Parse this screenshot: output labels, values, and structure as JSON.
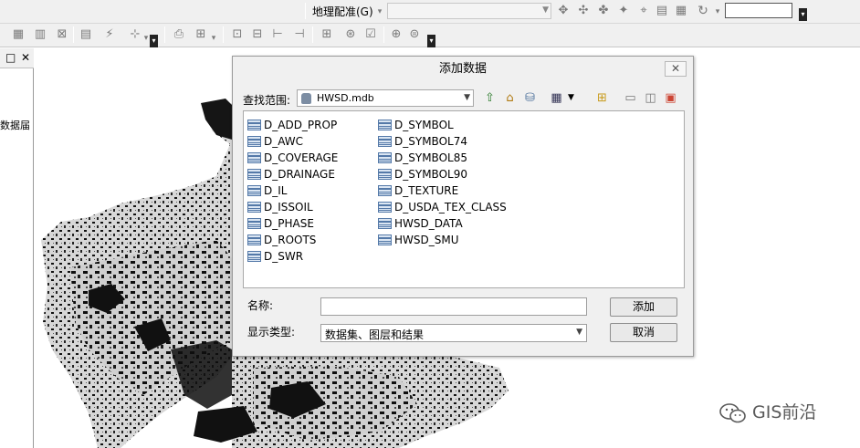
{
  "toolbar": {
    "georeferencing_label": "地理配准(G)",
    "georeferencing_layer_value": "",
    "scale_field_value": ""
  },
  "left_panel": {
    "restore_icon": "restore-icon",
    "close_icon": "close-icon",
    "partial_text": "数据届"
  },
  "dialog": {
    "title": "添加数据",
    "close_label": "✕",
    "look_in_label": "查找范围:",
    "look_in_value": "HWSD.mdb",
    "files_col1": [
      "D_ADD_PROP",
      "D_AWC",
      "D_COVERAGE",
      "D_DRAINAGE",
      "D_IL",
      "D_ISSOIL",
      "D_PHASE",
      "D_ROOTS",
      "D_SWR"
    ],
    "files_col2": [
      "D_SYMBOL",
      "D_SYMBOL74",
      "D_SYMBOL85",
      "D_SYMBOL90",
      "D_TEXTURE",
      "D_USDA_TEX_CLASS",
      "HWSD_DATA",
      "HWSD_SMU"
    ],
    "name_label": "名称:",
    "name_value": "",
    "show_type_label": "显示类型:",
    "show_type_value": "数据集、图层和结果",
    "add_button": "添加",
    "cancel_button": "取消"
  },
  "watermark": {
    "text": "GIS前沿"
  },
  "colors": {
    "highlight_box": "#e0001b",
    "dialog_bg": "#f0f0f0",
    "map_dark": "#111111",
    "map_light": "#d7d7d7"
  }
}
